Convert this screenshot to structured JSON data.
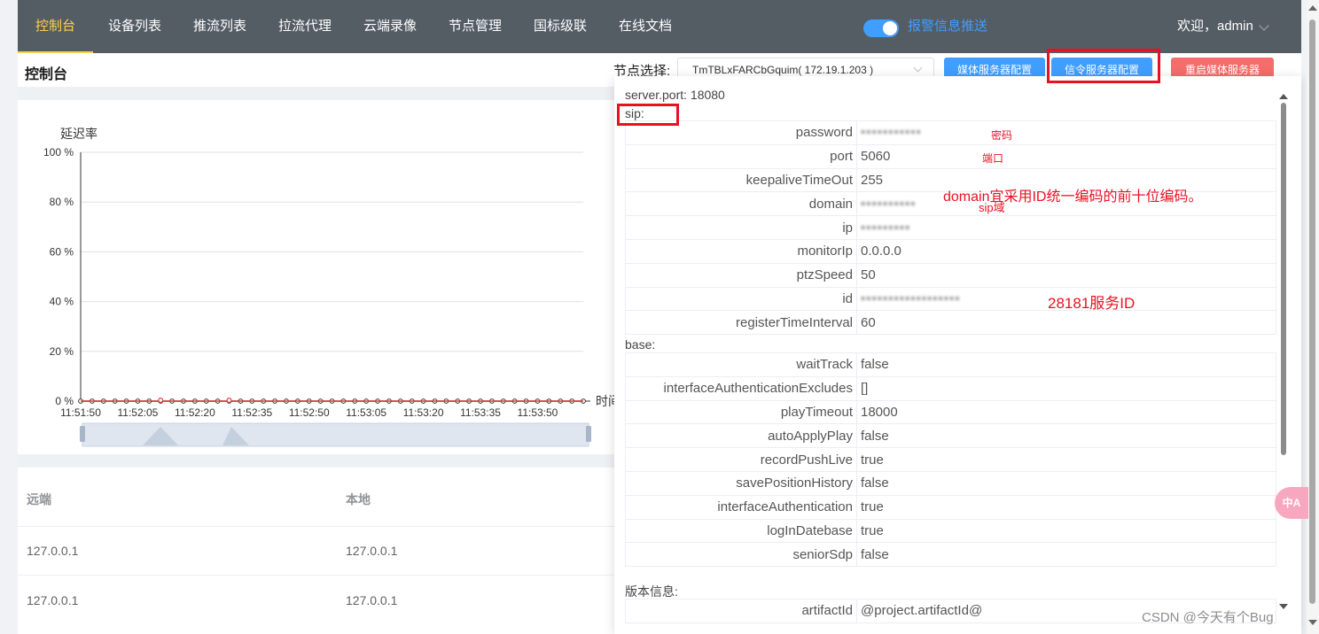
{
  "nav": {
    "items": [
      "控制台",
      "设备列表",
      "推流列表",
      "拉流代理",
      "云端录像",
      "节点管理",
      "国标级联",
      "在线文档"
    ],
    "active_index": 0,
    "alarm_push_label": "报警信息推送",
    "welcome": "欢迎，admin"
  },
  "header": {
    "page_title": "控制台",
    "node_label": "节点选择:",
    "node_value": "TmTBLxFARCbGquim( 172.19.1.203 )",
    "btn_media_config": "媒体服务器配置",
    "btn_signal_config": "信令服务器配置",
    "btn_restart_media": "重启媒体服务器"
  },
  "chart_data": {
    "type": "line",
    "ylabel": "延迟率",
    "xlabel_partial": "时间",
    "ylim": [
      0,
      100
    ],
    "yticks": [
      "0 %",
      "20 %",
      "40 %",
      "60 %",
      "80 %",
      "100 %"
    ],
    "categories": [
      "11:51:50",
      "11:52:05",
      "11:52:20",
      "11:52:35",
      "11:52:50",
      "11:53:05",
      "11:53:20",
      "11:53:35",
      "11:53:50"
    ],
    "series": [
      {
        "name": "",
        "values": [
          0,
          0,
          0,
          0,
          0,
          0,
          0,
          0,
          0,
          0,
          0,
          0,
          0,
          0,
          0,
          0,
          0,
          0,
          0,
          0,
          0,
          0,
          0,
          0,
          0,
          0,
          0,
          0,
          0,
          0,
          0,
          0,
          0,
          0,
          0,
          0,
          0,
          0,
          0,
          0,
          0,
          0,
          0,
          0,
          0
        ],
        "color": "#333333"
      },
      {
        "name": "",
        "values": [
          0,
          0,
          0,
          0,
          0,
          0,
          0,
          0,
          0,
          0,
          0,
          0,
          0,
          0,
          0,
          0,
          0,
          0,
          0,
          0,
          0,
          0,
          0,
          0,
          0,
          0,
          0,
          0,
          0,
          0,
          0,
          0,
          0,
          0,
          0,
          0,
          0,
          0,
          0,
          0,
          0,
          0,
          0,
          0,
          0
        ],
        "color": "#e04040"
      }
    ],
    "grid": true
  },
  "table": {
    "headers": [
      "远端",
      "本地"
    ],
    "rows": [
      [
        "127.0.0.1",
        "127.0.0.1"
      ],
      [
        "127.0.0.1",
        "127.0.0.1"
      ]
    ]
  },
  "dialog": {
    "server_port_line": "server.port:  18080",
    "sip_label": "sip:",
    "sip_rows": [
      {
        "key": "password",
        "value": "•••••••••••",
        "blurred": true
      },
      {
        "key": "port",
        "value": "5060",
        "blurred": false
      },
      {
        "key": "keepaliveTimeOut",
        "value": "255",
        "blurred": false
      },
      {
        "key": "domain",
        "value": "••••••••••",
        "blurred": true
      },
      {
        "key": "ip",
        "value": "•••••••••",
        "blurred": true
      },
      {
        "key": "monitorIp",
        "value": "0.0.0.0",
        "blurred": false
      },
      {
        "key": "ptzSpeed",
        "value": "50",
        "blurred": false
      },
      {
        "key": "id",
        "value": "••••••••••••••••••",
        "blurred": true
      },
      {
        "key": "registerTimeInterval",
        "value": "60",
        "blurred": false
      }
    ],
    "base_label": "base:",
    "base_rows": [
      {
        "key": "waitTrack",
        "value": "false"
      },
      {
        "key": "interfaceAuthenticationExcludes",
        "value": "[]"
      },
      {
        "key": "playTimeout",
        "value": "18000"
      },
      {
        "key": "autoApplyPlay",
        "value": "false"
      },
      {
        "key": "recordPushLive",
        "value": "true"
      },
      {
        "key": "savePositionHistory",
        "value": "false"
      },
      {
        "key": "interfaceAuthentication",
        "value": "true"
      },
      {
        "key": "logInDatebase",
        "value": "true"
      },
      {
        "key": "seniorSdp",
        "value": "false"
      }
    ],
    "version_label": "版本信息:",
    "version_rows": [
      {
        "key": "artifactId",
        "value": "@project.artifactId@"
      }
    ]
  },
  "annotations": {
    "password_note": "密码",
    "port_note": "端口",
    "domain_note": "domain宜采用ID统一编码的前十位编码。",
    "sip_domain_note": "sip域",
    "id_note": "28181服务ID",
    "annotation_color": "#e81123"
  },
  "float_button": "中A",
  "watermark": "CSDN @今天有个Bug"
}
